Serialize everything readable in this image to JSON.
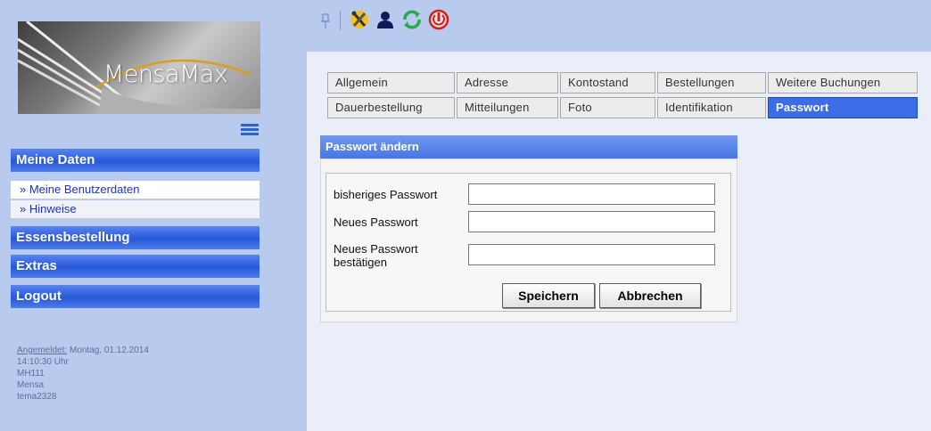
{
  "logo": {
    "text": "MensaMax"
  },
  "sidebar": {
    "menu_toggle_icon": "hamburger-icon",
    "sections": [
      {
        "label": "Meine Daten",
        "items": [
          "» Meine Benutzerdaten",
          "» Hinweise"
        ]
      },
      {
        "label": "Essensbestellung"
      },
      {
        "label": "Extras"
      },
      {
        "label": "Logout"
      }
    ]
  },
  "login_info": {
    "label": "Angemeldet:",
    "date": "Montag, 01.12.2014",
    "time": "14:10:30 Uhr",
    "line3": "MH111",
    "line4": "Mensa",
    "line5": "tema2328"
  },
  "toolbar": {
    "icons": [
      "pin-icon",
      "tools-icon",
      "user-icon",
      "refresh-icon",
      "power-icon"
    ]
  },
  "tabs": {
    "row1": [
      "Allgemein",
      "Adresse",
      "Kontostand",
      "Bestellungen",
      "Weitere Buchungen"
    ],
    "row2": [
      "Dauerbestellung",
      "Mitteilungen",
      "Foto",
      "Identifikation",
      "Passwort"
    ],
    "active": "Passwort"
  },
  "panel": {
    "title": "Passwort ändern",
    "fields": [
      {
        "label": "bisheriges Passwort",
        "value": ""
      },
      {
        "label": "Neues Passwort",
        "value": ""
      },
      {
        "label_line1": "Neues Passwort",
        "label_line2": "bestätigen",
        "value": ""
      }
    ],
    "save_label": "Speichern",
    "cancel_label": "Abbrechen"
  },
  "colors": {
    "sidebar_bg": "#b8cbee",
    "nav_header": "#2e5fe0",
    "active_tab": "#3c6de6",
    "link_color": "#1a35c8"
  }
}
